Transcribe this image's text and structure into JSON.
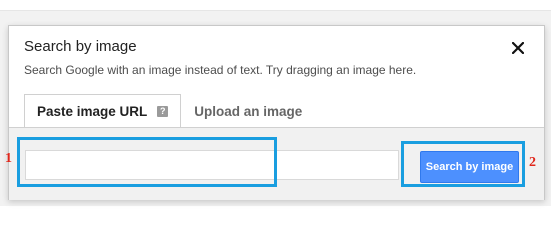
{
  "dialog": {
    "title": "Search by image",
    "subtitle": "Search Google with an image instead of text. Try dragging an image here.",
    "close_icon": "close-icon"
  },
  "tabs": [
    {
      "label": "Paste image URL",
      "active": true,
      "help_icon": "?"
    },
    {
      "label": "Upload an image",
      "active": false
    }
  ],
  "url_input": {
    "value": "",
    "placeholder": ""
  },
  "search_button": {
    "label": "Search by image",
    "color": "#4d90fe"
  },
  "annotations": {
    "marker_1": "1",
    "marker_2": "2",
    "highlight_color": "#1a9ee0",
    "marker_color": "#e0261b"
  }
}
